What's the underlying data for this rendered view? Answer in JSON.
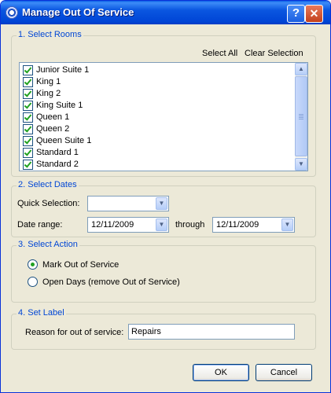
{
  "window": {
    "title": "Manage Out Of Service",
    "help_label": "?",
    "close_label": "✕"
  },
  "rooms": {
    "legend": "1. Select Rooms",
    "select_all": "Select All",
    "clear_selection": "Clear Selection",
    "items": [
      {
        "label": "Junior Suite 1",
        "checked": true
      },
      {
        "label": "King 1",
        "checked": true
      },
      {
        "label": "King 2",
        "checked": true
      },
      {
        "label": "King Suite 1",
        "checked": true
      },
      {
        "label": "Queen 1",
        "checked": true
      },
      {
        "label": "Queen 2",
        "checked": true
      },
      {
        "label": "Queen Suite 1",
        "checked": true
      },
      {
        "label": "Standard 1",
        "checked": true
      },
      {
        "label": "Standard 2",
        "checked": true
      }
    ]
  },
  "dates": {
    "legend": "2. Select Dates",
    "quick_label": "Quick Selection:",
    "quick_value": "",
    "range_label": "Date range:",
    "from": "12/11/2009",
    "through_label": "through",
    "to": "12/11/2009"
  },
  "action": {
    "legend": "3. Select Action",
    "options": [
      {
        "label": "Mark Out of Service",
        "selected": true
      },
      {
        "label": "Open Days (remove Out of Service)",
        "selected": false
      }
    ]
  },
  "label": {
    "legend": "4. Set Label",
    "reason_label": "Reason for out of service:",
    "reason_value": "Repairs"
  },
  "buttons": {
    "ok": "OK",
    "cancel": "Cancel"
  },
  "colors": {
    "accent": "#0046d5",
    "check": "#21a121"
  },
  "icons": {
    "dropdown": "▼",
    "scroll_up": "▲",
    "scroll_down": "▼"
  }
}
